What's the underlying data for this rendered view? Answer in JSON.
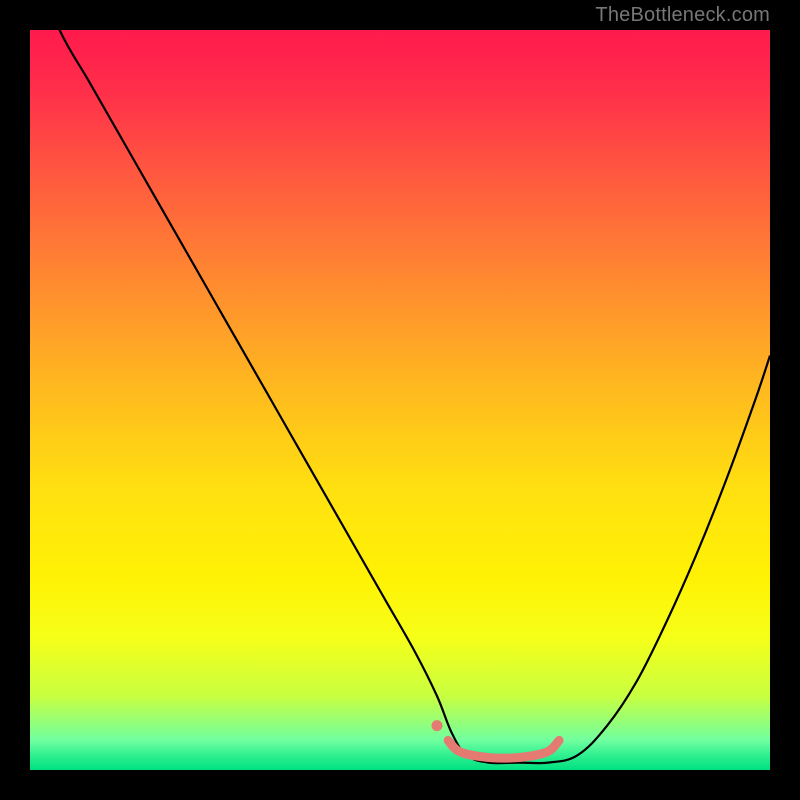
{
  "watermark": "TheBottleneck.com",
  "chart_data": {
    "type": "line",
    "title": "",
    "xlabel": "",
    "ylabel": "",
    "xlim": [
      0,
      100
    ],
    "ylim": [
      0,
      100
    ],
    "grid": false,
    "series": [
      {
        "name": "curve",
        "color": "#000000",
        "width": 2.2,
        "x": [
          0,
          4,
          8,
          12,
          16,
          20,
          24,
          28,
          32,
          36,
          40,
          44,
          48,
          52,
          55,
          57,
          59,
          62,
          66,
          70,
          74,
          78,
          82,
          86,
          90,
          94,
          98,
          100
        ],
        "y": [
          110,
          100,
          93,
          86,
          79,
          72,
          65,
          58,
          51,
          44,
          37,
          30,
          23,
          16,
          10,
          5,
          2,
          1,
          1,
          1,
          2,
          6,
          12,
          20,
          29,
          39,
          50,
          56
        ]
      },
      {
        "name": "flat-marker",
        "color": "#e47a72",
        "type": "marker",
        "width": 9,
        "cap": "round",
        "x": [
          56.5,
          58,
          61,
          64,
          67,
          70,
          71.5
        ],
        "y": [
          4.0,
          2.5,
          1.8,
          1.6,
          1.8,
          2.5,
          4.0
        ]
      },
      {
        "name": "dot",
        "type": "dot",
        "color": "#e47a72",
        "x": 55,
        "y": 6,
        "r": 5.5
      }
    ],
    "annotations": [
      {
        "text": "TheBottleneck.com",
        "role": "watermark",
        "position": "top-right"
      }
    ]
  }
}
